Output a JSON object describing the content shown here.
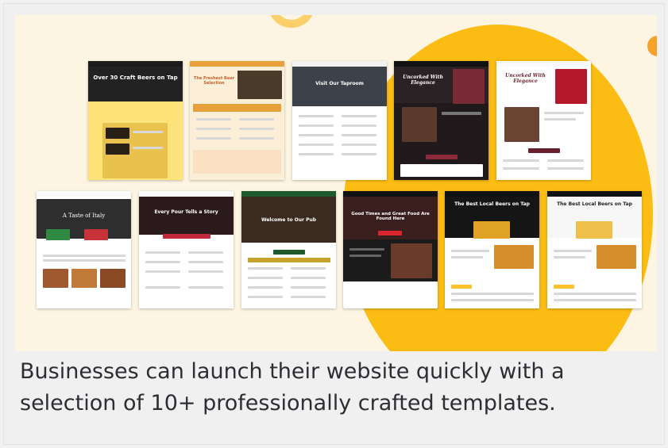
{
  "caption": "Businesses can launch their website quickly with a selection of 10+ professionally crafted templates.",
  "colors": {
    "background": "#f1f1f2",
    "hero_background": "#fdf4e2",
    "accent_yellow": "#fbbd13",
    "accent_orange": "#f6a12b",
    "caption_text": "#2d2d33"
  },
  "templates": [
    {
      "title": "Over 30 Craft Beers on Tap",
      "theme": "yellow"
    },
    {
      "title": "The Freshest Beer Selection",
      "theme": "cream"
    },
    {
      "title": "Visit Our Taproom",
      "theme": "dark"
    },
    {
      "title": "Uncorked With Elegance",
      "theme": "wine-dark"
    },
    {
      "title": "Uncorked With Elegance",
      "theme": "wine-light"
    },
    {
      "title": "A Taste of Italy",
      "theme": "italian"
    },
    {
      "title": "Every Pour Tells a Story",
      "theme": "red-wine"
    },
    {
      "title": "Welcome to Our Pub",
      "theme": "green-pub"
    },
    {
      "title": "Good Times and Great Food Are Found Here",
      "theme": "dark-red"
    },
    {
      "title": "The Best Local Beers on Tap",
      "theme": "beer-dark"
    },
    {
      "title": "The Best Local Beers on Tap",
      "theme": "beer-light"
    }
  ]
}
